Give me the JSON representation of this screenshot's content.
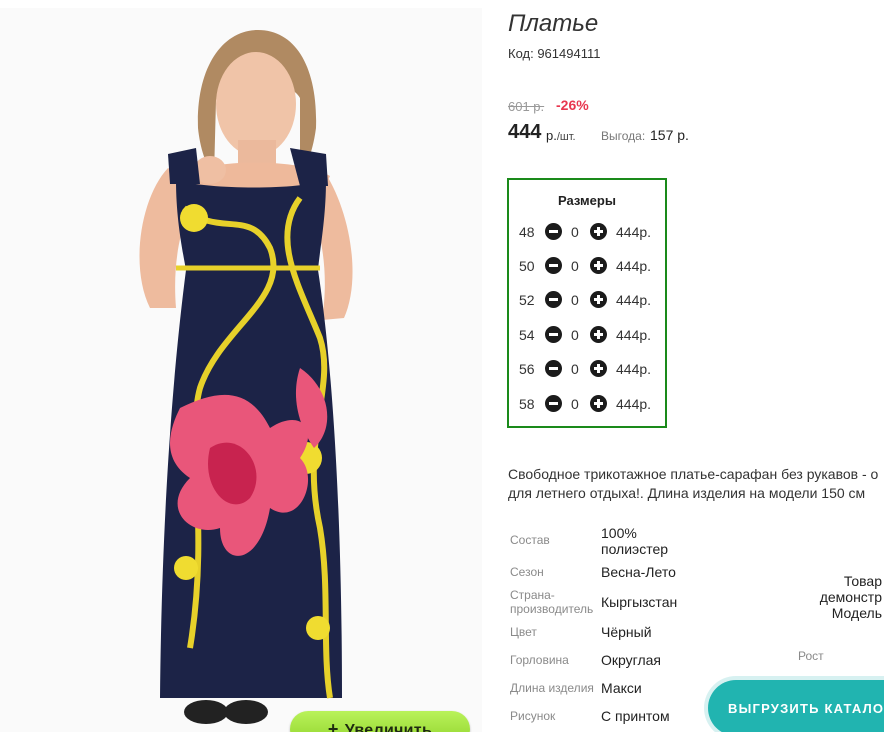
{
  "product": {
    "title": "Платье",
    "code_text": "Код: 961494111",
    "old_price": "601 р.",
    "discount": "-26%",
    "price": "444",
    "price_unit": "р.",
    "price_per": "/шт.",
    "benefit_label": "Выгода:",
    "benefit_value": "157 р."
  },
  "sizes": {
    "title": "Размеры",
    "rows": [
      {
        "size": "48",
        "qty": "0",
        "price": "444р."
      },
      {
        "size": "50",
        "qty": "0",
        "price": "444р."
      },
      {
        "size": "52",
        "qty": "0",
        "price": "444р."
      },
      {
        "size": "54",
        "qty": "0",
        "price": "444р."
      },
      {
        "size": "56",
        "qty": "0",
        "price": "444р."
      },
      {
        "size": "58",
        "qty": "0",
        "price": "444р."
      }
    ]
  },
  "description": {
    "line1": "Свободное трикотажное платье-сарафан без рукавов - о",
    "line2": "для летнего отдыха!. Длина изделия на модели 150 см"
  },
  "attributes": [
    {
      "label": "Состав",
      "value_line1": "100%",
      "value_line2": "полиэстер"
    },
    {
      "label": "Сезон",
      "value": "Весна-Лето"
    },
    {
      "label_line1": "Страна-",
      "label_line2": "производитель",
      "value": "Кыргызстан"
    },
    {
      "label": "Цвет",
      "value": "Чёрный"
    },
    {
      "label": "Горловина",
      "value": "Округлая"
    },
    {
      "label": "Длина изделия",
      "value": "Макси"
    },
    {
      "label": "Рисунок",
      "value": "С принтом"
    }
  ],
  "side_note": {
    "line1": "Товар",
    "line2": "демонстр",
    "line3": "Модель"
  },
  "rost_label": "Рост",
  "buttons": {
    "zoom": "Увеличить",
    "zoom_icon": "+",
    "export": "ВЫГРУЗИТЬ КАТАЛОГ"
  },
  "colors": {
    "accent_green": "#1a8a1a",
    "discount_red": "#e8364f",
    "teal": "#21b4b0",
    "zoom_green": "#9ede3c"
  }
}
